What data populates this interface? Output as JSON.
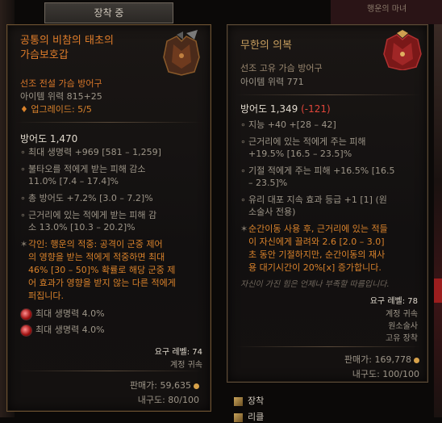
{
  "background": {
    "top_right_label": "행운의 마녀"
  },
  "equipped_tab": {
    "label": "장착 중"
  },
  "left_item": {
    "name_line1": "공통의 비참의 태초의",
    "name_line2": "가슴보호갑",
    "type": "선조 전설 가슴 방어구",
    "item_power": "아이템 위력 815+25",
    "upgrades": "업그레이드: 5/5",
    "armor": "방어도 1,470",
    "stats": [
      {
        "line1": "최대 생명력 +969 [581 – 1,259]",
        "line2": ""
      },
      {
        "line1": "불타오를 적에게 받는 피해 감소",
        "line2": "11.0% [7.4 – 17.4]%"
      },
      {
        "line1": "총 방어도 +7.2% [3.0 – 7.2]%",
        "line2": ""
      },
      {
        "line1": "근거리에 있는 적에게 받는 피해 감",
        "line2": "소 13.0% [10.3 – 20.2]%"
      }
    ],
    "aspect": {
      "lines": [
        "각인: 행운의 적중: 공격이 군중 제어",
        "의 영향을 받는 적에게 적중하면 최대",
        "46% [30 – 50]% 확률로 해당 군중 제",
        "어 효과가 영향을 받지 않는 다른 적에게",
        "퍼집니다."
      ]
    },
    "sockets": [
      {
        "text": "최대 생명력 4.0%"
      },
      {
        "text": "최대 생명력 4.0%"
      }
    ],
    "required_level": "요구 레벨: 74",
    "account_bound": "계정 귀속",
    "sell_value": "판매가: 59,635",
    "durability": "내구도: 80/100"
  },
  "right_item": {
    "name": "무한의 의복",
    "type": "선조 고유 가슴 방어구",
    "item_power": "아이템 위력 771",
    "armor": "방어도 1,349",
    "armor_diff": "(-121)",
    "stats": [
      {
        "line1": "지능 +40 +[28 – 42]",
        "line2": ""
      },
      {
        "line1": "근거리에 있는 적에게 주는 피해",
        "line2": "+19.5% [16.5 – 23.5]%"
      },
      {
        "line1": "기절 적에게 주는 피해 +16.5% [16.5",
        "line2": "– 23.5]%"
      },
      {
        "line1": "유리 대포 지속 효과 등급 +1 [1] (원",
        "line2": "소술사 전용)"
      }
    ],
    "unique_power": {
      "lines": [
        "순간이동 사용 후, 근거리에 있는 적들",
        "이 자신에게 끌려와 2.6 [2.0 – 3.0]",
        "초 동안 기절하지만, 순간이동의 재사",
        "용 대기시간이 20%[x] 증가합니다."
      ]
    },
    "flavor": "자신이 가진 힘은 언제나 부족할 따름입니다.",
    "required_level": "요구 레벨: 78",
    "account_bound": "계정 귀속",
    "class_restriction": "원소술사",
    "unique_equipped": "고유 장착",
    "sell_value": "판매가: 169,778",
    "durability": "내구도: 100/100"
  },
  "bottom_menu": {
    "items": [
      {
        "label": "장착"
      },
      {
        "label": "리클"
      }
    ]
  },
  "colors": {
    "legendary": "#e07d2a",
    "unique": "#c79e5e",
    "affix_blue": "#6f8fd9",
    "negative_red": "#e0463a"
  }
}
